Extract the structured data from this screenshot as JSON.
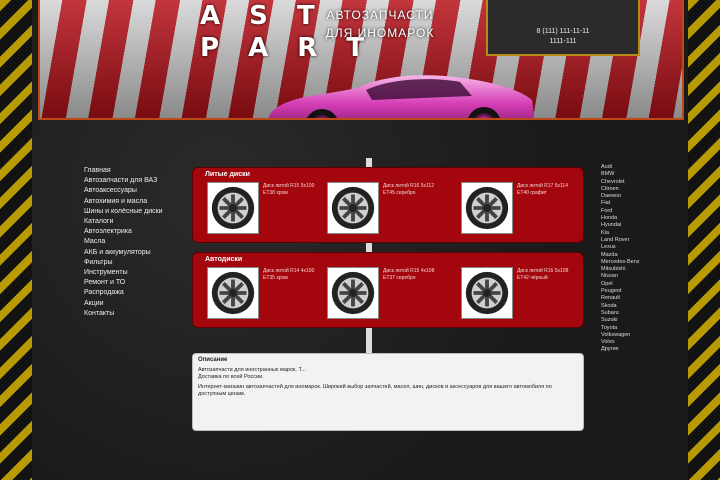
{
  "colors": {
    "accent_red": "#a3070d",
    "hazard_yellow": "#c9a800",
    "header_border": "#c04a16",
    "contact_border": "#b98a14"
  },
  "header": {
    "logo_line1": "A S T",
    "logo_line2": "P A R T",
    "tagline_line1": "АВТОЗАПЧАСТИ",
    "tagline_line2": "ДЛЯ ИНОМАРОК",
    "phone1": "8 (111) 111-11-11",
    "phone2": "1111-111"
  },
  "nav": {
    "items": [
      {
        "label": "Главная"
      },
      {
        "label": "Автозапчасти для ВАЗ"
      },
      {
        "label": "Автоаксессуары"
      },
      {
        "label": "Автохимия и масла"
      },
      {
        "label": "Шины и колёсные диски"
      },
      {
        "label": "Каталоги"
      },
      {
        "label": "Автоэлектрика"
      },
      {
        "label": "Масла"
      },
      {
        "label": "АКБ и аккумуляторы"
      },
      {
        "label": "Фильтры"
      },
      {
        "label": "Инструменты"
      },
      {
        "label": "Ремонт и ТО"
      },
      {
        "label": "Распродажа"
      },
      {
        "label": "Акции"
      },
      {
        "label": "Контакты"
      }
    ]
  },
  "panels": [
    {
      "title": "Литые диски",
      "products": [
        {
          "icon": "wheel-icon",
          "desc": "Диск литой R15 5x100 ET38 хром"
        },
        {
          "icon": "wheel-icon",
          "desc": "Диск литой R16 5x112 ET45 серебро"
        },
        {
          "icon": "wheel-icon",
          "desc": "Диск литой R17 5x114 ET40 графит"
        }
      ]
    },
    {
      "title": "Автодиски",
      "products": [
        {
          "icon": "wheel-icon",
          "desc": "Диск литой R14 4x100 ET35 хром"
        },
        {
          "icon": "wheel-icon",
          "desc": "Диск литой R15 4x108 ET37 серебро"
        },
        {
          "icon": "wheel-icon",
          "desc": "Диск литой R16 5x108 ET42 чёрный"
        }
      ]
    }
  ],
  "text_box": {
    "title": "Описание",
    "line1": "Автозапчасти для иностранных марок. Т...",
    "line2": "Доставка по всей России.",
    "line3": "Интернет-магазин автозапчастей для иномарок. Широкий выбор запчастей, масел, шин, дисков и аксессуаров для вашего автомобиля по доступным ценам."
  },
  "right_list": {
    "items": [
      "Audi",
      "BMW",
      "Chevrolet",
      "Citroen",
      "Daewoo",
      "Fiat",
      "Ford",
      "Honda",
      "Hyundai",
      "Kia",
      "Land Rover",
      "Lexus",
      "Mazda",
      "Mercedes-Benz",
      "Mitsubishi",
      "Nissan",
      "Opel",
      "Peugeot",
      "Renault",
      "Skoda",
      "Subaru",
      "Suzuki",
      "Toyota",
      "Volkswagen",
      "Volvo",
      "Другие"
    ]
  }
}
